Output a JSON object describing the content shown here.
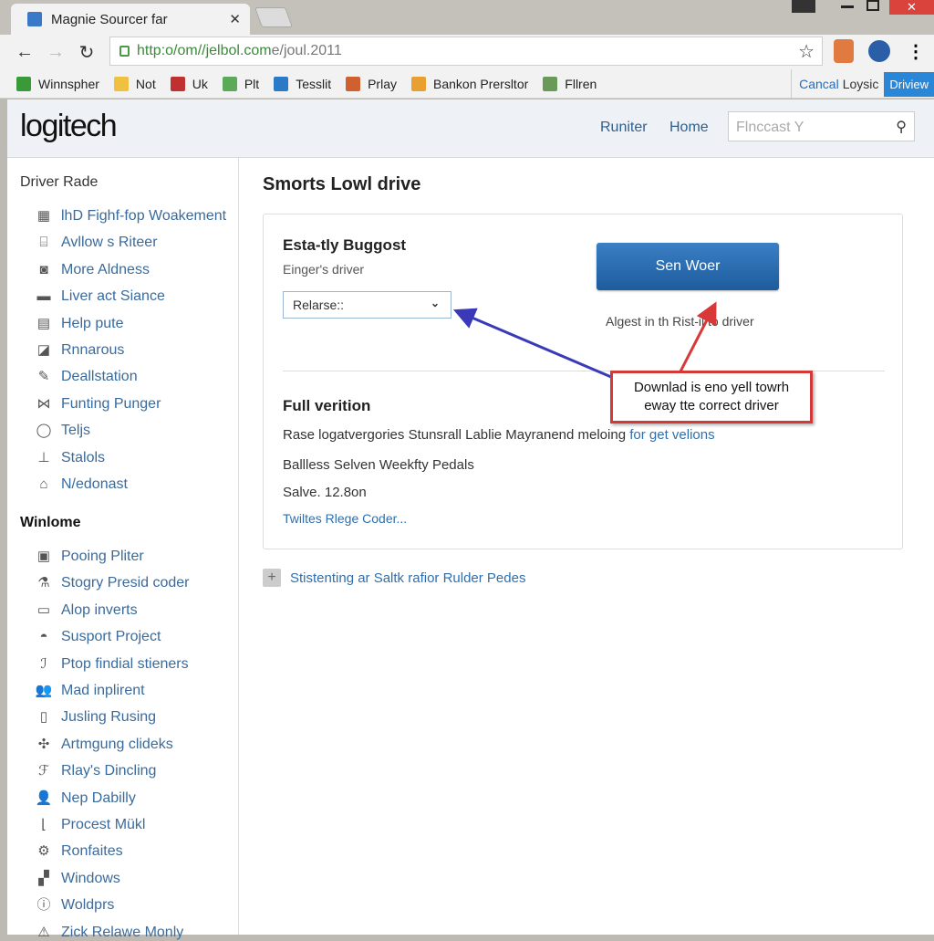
{
  "browser": {
    "tab_title": "Magnie Sourcer far",
    "url_green": "http:o/om//jelbol.com",
    "url_rest": " e/joul.2011",
    "bookmarks": [
      {
        "label": "Winnspher",
        "color": "#3a9a3a"
      },
      {
        "label": "Not",
        "color": "#f0c040"
      },
      {
        "label": "Uk",
        "color": "#c03030"
      },
      {
        "label": "Plt",
        "color": "#5aaa5a"
      },
      {
        "label": "Tesslit",
        "color": "#2a7ac8"
      },
      {
        "label": "Prlay",
        "color": "#d06030"
      },
      {
        "label": "Bankon Prersltor",
        "color": "#e8a030"
      },
      {
        "label": "Fllren",
        "color": "#6a9a5a"
      }
    ],
    "right_cancel": "Cancal",
    "right_loysic": "Loysic",
    "right_driview": "Driview"
  },
  "site": {
    "logo": "logitech",
    "nav": [
      "Runiter",
      "Home"
    ],
    "search_placeholder": "Flnccast Y"
  },
  "sidebar": {
    "section1": "Driver Rade",
    "items1": [
      "lhD Fighf-fop Woakement",
      "Avllow s Riteer",
      "More Aldness",
      "Liver act Siance",
      "Help pute",
      "Rnnarous",
      "Deallstation",
      "Funting Punger",
      "Teljs",
      "Stalols",
      "N/edonast"
    ],
    "section2": "Winlome",
    "items2": [
      "Pooing Pliter",
      "Stogry Presid coder",
      "Alop inverts",
      "Susport Project",
      "Ptop findial stieners",
      "Mad inplirent",
      "Jusling Rusing",
      "Artmgung clideks",
      "Rlay's Dincling",
      "Nep Dabilly",
      "Procest Mükl",
      "Ronfaites",
      "Windows",
      "Woldprs",
      "Zick Relawe Monly"
    ]
  },
  "main": {
    "title": "Smorts Lowl drive",
    "card": {
      "heading": "Esta-tly Buggost",
      "sublabel": "Einger's driver",
      "select_value": "Relarse::",
      "button": "Sen Woer",
      "button_note": "Algest in th Rist-il to driver",
      "callout": "Downlad is eno yell towrh eway tte correct driver",
      "full_heading": "Full verition",
      "desc": "Rase logatvergories Stunsrall Lablie Mayranend meloing ",
      "desc_link": "for get velions",
      "line2": "Ballless Selven Weekfty Pedals",
      "line3": "Salve.   12.8on",
      "link": "Twiltes Rlege Coder..."
    },
    "expand_link": "Stistenting ar Saltk rafior Rulder Pedes"
  },
  "colors": {
    "accent": "#2a6bb8",
    "button": "#2a6db0",
    "callout_border": "#d23a3a",
    "arrow_blue": "#3a3ab8",
    "arrow_red": "#d83838"
  }
}
